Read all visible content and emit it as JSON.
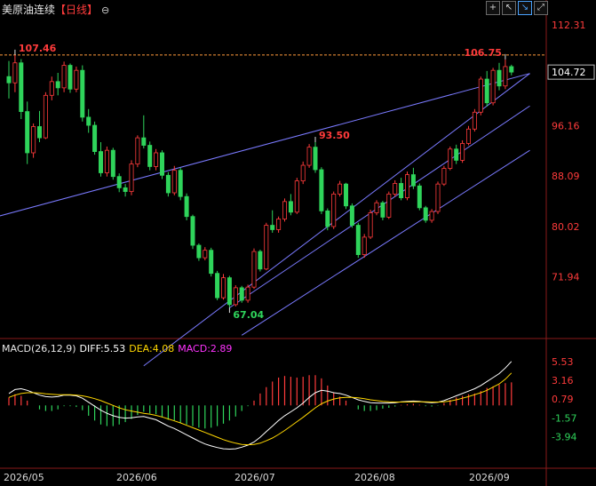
{
  "header": {
    "instrument": "美原油连续",
    "period": "【日线】",
    "settings_icon": "circle-minus-icon"
  },
  "toolbar": [
    {
      "name": "crosshair-icon",
      "glyph": "+"
    },
    {
      "name": "cursor-icon",
      "glyph": "↖"
    },
    {
      "name": "line-tool-icon",
      "glyph": "↘"
    },
    {
      "name": "expand-icon",
      "glyph": "⤢"
    }
  ],
  "colors": {
    "up": "#ff3b3b",
    "down": "#2fd45b",
    "background": "#000000",
    "dashed_price": "#ff9a3c",
    "channel": "#7a7aff",
    "diff": "#ffffff",
    "dea": "#ffd700",
    "macd_label": "#ff33ff"
  },
  "chart_data": {
    "type": "candlestick",
    "x_axis_labels": [
      "2026/05",
      "2026/06",
      "2026/07",
      "2026/08",
      "2026/09"
    ],
    "y_axis_ticks": [
      "112.31",
      "104.72",
      "96.16",
      "88.09",
      "80.02",
      "71.94"
    ],
    "y_range": [
      62.5,
      113.7
    ],
    "current_price": "104.72",
    "annotations": [
      {
        "label": "107.46",
        "kind": "high",
        "index": 1
      },
      {
        "label": "93.50",
        "kind": "high",
        "index": 50
      },
      {
        "label": "106.75",
        "kind": "high",
        "index": 81
      },
      {
        "label": "67.04",
        "kind": "low",
        "index": 36
      }
    ],
    "ohlc": [
      [
        104.0,
        106.5,
        100.5,
        103.0
      ],
      [
        103.0,
        107.46,
        101.5,
        106.2
      ],
      [
        106.2,
        106.8,
        97.2,
        98.4
      ],
      [
        98.4,
        100.0,
        90.0,
        91.8
      ],
      [
        91.8,
        96.5,
        91.0,
        96.0
      ],
      [
        96.0,
        98.5,
        93.5,
        94.2
      ],
      [
        94.2,
        101.5,
        94.0,
        101.0
      ],
      [
        101.0,
        104.0,
        100.2,
        103.2
      ],
      [
        103.2,
        104.6,
        101.0,
        102.2
      ],
      [
        102.2,
        106.4,
        101.5,
        105.8
      ],
      [
        105.8,
        106.1,
        101.4,
        102.0
      ],
      [
        102.0,
        105.6,
        101.5,
        105.0
      ],
      [
        105.0,
        105.8,
        96.8,
        97.5
      ],
      [
        97.5,
        98.8,
        95.0,
        96.2
      ],
      [
        96.2,
        96.8,
        91.5,
        92.0
      ],
      [
        92.0,
        93.5,
        88.0,
        88.6
      ],
      [
        88.6,
        92.8,
        88.0,
        92.2
      ],
      [
        92.2,
        92.6,
        87.5,
        88.0
      ],
      [
        88.0,
        88.5,
        85.5,
        86.2
      ],
      [
        86.2,
        86.8,
        84.8,
        85.6
      ],
      [
        85.6,
        90.6,
        85.0,
        90.0
      ],
      [
        90.0,
        94.6,
        89.5,
        94.2
      ],
      [
        94.2,
        97.8,
        92.5,
        93.0
      ],
      [
        93.0,
        93.6,
        89.0,
        89.6
      ],
      [
        89.6,
        92.4,
        89.0,
        91.8
      ],
      [
        91.8,
        92.2,
        87.6,
        88.2
      ],
      [
        88.2,
        88.7,
        84.8,
        85.4
      ],
      [
        85.4,
        89.7,
        85.0,
        89.0
      ],
      [
        89.0,
        89.4,
        84.2,
        84.8
      ],
      [
        84.8,
        85.3,
        81.0,
        81.6
      ],
      [
        81.6,
        81.9,
        76.4,
        77.0
      ],
      [
        77.0,
        77.3,
        74.5,
        75.0
      ],
      [
        75.0,
        76.7,
        74.6,
        76.2
      ],
      [
        76.2,
        76.6,
        72.0,
        72.5
      ],
      [
        72.5,
        72.9,
        68.2,
        68.6
      ],
      [
        68.6,
        72.4,
        68.3,
        71.8
      ],
      [
        71.8,
        72.1,
        67.04,
        67.5
      ],
      [
        67.5,
        70.6,
        67.2,
        70.2
      ],
      [
        70.2,
        70.5,
        67.8,
        68.2
      ],
      [
        68.2,
        70.7,
        67.8,
        70.3
      ],
      [
        70.3,
        76.5,
        70.0,
        76.0
      ],
      [
        76.0,
        76.3,
        72.8,
        73.2
      ],
      [
        73.2,
        80.6,
        73.0,
        80.2
      ],
      [
        80.2,
        82.6,
        79.0,
        79.5
      ],
      [
        79.5,
        81.6,
        79.0,
        81.2
      ],
      [
        81.2,
        84.5,
        80.8,
        84.0
      ],
      [
        84.0,
        85.2,
        81.8,
        82.3
      ],
      [
        82.3,
        87.8,
        82.0,
        87.3
      ],
      [
        87.3,
        90.4,
        86.8,
        89.8
      ],
      [
        89.8,
        93.2,
        89.4,
        92.7
      ],
      [
        92.7,
        93.5,
        88.6,
        89.1
      ],
      [
        89.1,
        89.5,
        82.0,
        82.5
      ],
      [
        82.5,
        82.9,
        79.4,
        80.0
      ],
      [
        80.0,
        85.6,
        79.6,
        85.2
      ],
      [
        85.2,
        87.3,
        84.8,
        86.8
      ],
      [
        86.8,
        87.0,
        82.8,
        83.3
      ],
      [
        83.3,
        83.7,
        79.8,
        80.2
      ],
      [
        80.2,
        80.6,
        75.0,
        75.5
      ],
      [
        75.5,
        78.8,
        75.0,
        78.3
      ],
      [
        78.3,
        82.7,
        78.0,
        82.2
      ],
      [
        82.2,
        84.2,
        81.8,
        83.8
      ],
      [
        83.8,
        84.1,
        81.0,
        81.5
      ],
      [
        81.5,
        85.6,
        81.2,
        85.2
      ],
      [
        85.2,
        87.4,
        84.8,
        86.9
      ],
      [
        86.9,
        87.8,
        84.2,
        84.6
      ],
      [
        84.6,
        88.8,
        84.2,
        88.3
      ],
      [
        88.3,
        89.4,
        86.0,
        86.5
      ],
      [
        86.5,
        86.9,
        82.6,
        83.0
      ],
      [
        83.0,
        83.3,
        80.6,
        81.0
      ],
      [
        81.0,
        82.8,
        80.6,
        82.4
      ],
      [
        82.4,
        87.2,
        82.0,
        86.8
      ],
      [
        86.8,
        89.7,
        86.5,
        89.3
      ],
      [
        89.3,
        92.8,
        89.0,
        92.4
      ],
      [
        92.4,
        93.1,
        90.0,
        90.6
      ],
      [
        90.6,
        93.8,
        90.2,
        93.3
      ],
      [
        93.3,
        96.1,
        93.0,
        95.6
      ],
      [
        95.6,
        98.8,
        95.2,
        98.3
      ],
      [
        98.3,
        104.0,
        97.8,
        103.6
      ],
      [
        103.6,
        104.9,
        99.2,
        99.8
      ],
      [
        99.8,
        105.4,
        99.4,
        105.0
      ],
      [
        105.0,
        106.2,
        101.8,
        102.5
      ],
      [
        102.5,
        106.75,
        102.0,
        105.6
      ],
      [
        105.6,
        105.9,
        104.2,
        104.72
      ]
    ],
    "trendlines": [
      {
        "from": [
          -3,
          81.3
        ],
        "to": [
          85,
          104.5
        ]
      },
      {
        "from": [
          22,
          57.7
        ],
        "to": [
          85,
          104.5
        ]
      },
      {
        "from": [
          36,
          67.0
        ],
        "to": [
          85,
          99.3
        ]
      },
      {
        "from": [
          38,
          62.6
        ],
        "to": [
          85,
          92.2
        ]
      }
    ],
    "macd": {
      "header": {
        "name": "MACD(26,12,9)",
        "diff": "DIFF:5.53",
        "dea": "DEA:4.08",
        "macd": "MACD:2.89"
      },
      "y_ticks": [
        "5.53",
        "3.16",
        "0.79",
        "-1.57",
        "-3.94"
      ],
      "y_range": [
        -6.0,
        6.4
      ],
      "diff": [
        1.5,
        2.0,
        2.1,
        1.9,
        1.6,
        1.3,
        1.1,
        1.05,
        1.1,
        1.3,
        1.3,
        1.2,
        0.9,
        0.4,
        -0.1,
        -0.6,
        -1.0,
        -1.3,
        -1.5,
        -1.6,
        -1.55,
        -1.45,
        -1.4,
        -1.6,
        -1.8,
        -2.2,
        -2.6,
        -2.9,
        -3.3,
        -3.7,
        -4.1,
        -4.5,
        -4.85,
        -5.1,
        -5.3,
        -5.45,
        -5.5,
        -5.45,
        -5.25,
        -5.0,
        -4.6,
        -4.0,
        -3.3,
        -2.6,
        -1.9,
        -1.3,
        -0.8,
        -0.3,
        0.3,
        1.0,
        1.6,
        1.9,
        1.8,
        1.6,
        1.5,
        1.3,
        1.0,
        0.7,
        0.5,
        0.35,
        0.3,
        0.3,
        0.3,
        0.35,
        0.45,
        0.5,
        0.55,
        0.5,
        0.4,
        0.35,
        0.4,
        0.6,
        0.9,
        1.2,
        1.5,
        1.8,
        2.1,
        2.5,
        3.0,
        3.5,
        4.0,
        4.7,
        5.53
      ],
      "dea": [
        1.0,
        1.3,
        1.5,
        1.6,
        1.6,
        1.55,
        1.45,
        1.4,
        1.35,
        1.35,
        1.35,
        1.3,
        1.2,
        1.05,
        0.85,
        0.6,
        0.3,
        0.0,
        -0.3,
        -0.55,
        -0.7,
        -0.85,
        -1.0,
        -1.1,
        -1.25,
        -1.45,
        -1.7,
        -1.95,
        -2.2,
        -2.5,
        -2.8,
        -3.1,
        -3.4,
        -3.7,
        -4.0,
        -4.3,
        -4.55,
        -4.75,
        -4.9,
        -4.95,
        -4.9,
        -4.75,
        -4.45,
        -4.1,
        -3.65,
        -3.15,
        -2.6,
        -2.05,
        -1.5,
        -0.9,
        -0.3,
        0.2,
        0.55,
        0.8,
        0.95,
        1.0,
        1.0,
        0.95,
        0.85,
        0.7,
        0.6,
        0.5,
        0.45,
        0.42,
        0.42,
        0.43,
        0.45,
        0.46,
        0.45,
        0.42,
        0.42,
        0.45,
        0.55,
        0.7,
        0.9,
        1.1,
        1.35,
        1.6,
        1.9,
        2.3,
        2.7,
        3.3,
        4.08
      ]
    }
  }
}
